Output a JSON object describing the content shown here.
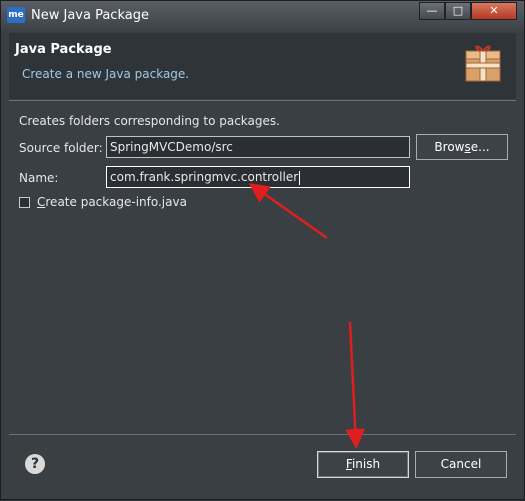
{
  "window": {
    "title": "New Java Package",
    "app_icon_text": "me"
  },
  "header": {
    "title": "Java Package",
    "description": "Create a new Java package.",
    "icon": "package-icon"
  },
  "body": {
    "intro": "Creates folders corresponding to packages.",
    "source_folder": {
      "label": "Source folder:",
      "value": "SpringMVCDemo/src",
      "browse_prefix": "Brow",
      "browse_mnemonic": "s",
      "browse_suffix": "e..."
    },
    "name": {
      "label": "Name:",
      "value": "com.frank.springmvc.controller"
    },
    "create_info": {
      "label_mnemonic": "C",
      "label_rest": "reate package-info.java",
      "checked": false
    }
  },
  "footer": {
    "help_glyph": "?",
    "finish": {
      "mnemonic": "F",
      "rest": "inish"
    },
    "cancel": "Cancel"
  },
  "colors": {
    "annotation_arrow": "#e01e1e",
    "header_desc": "#9fc9e6"
  }
}
